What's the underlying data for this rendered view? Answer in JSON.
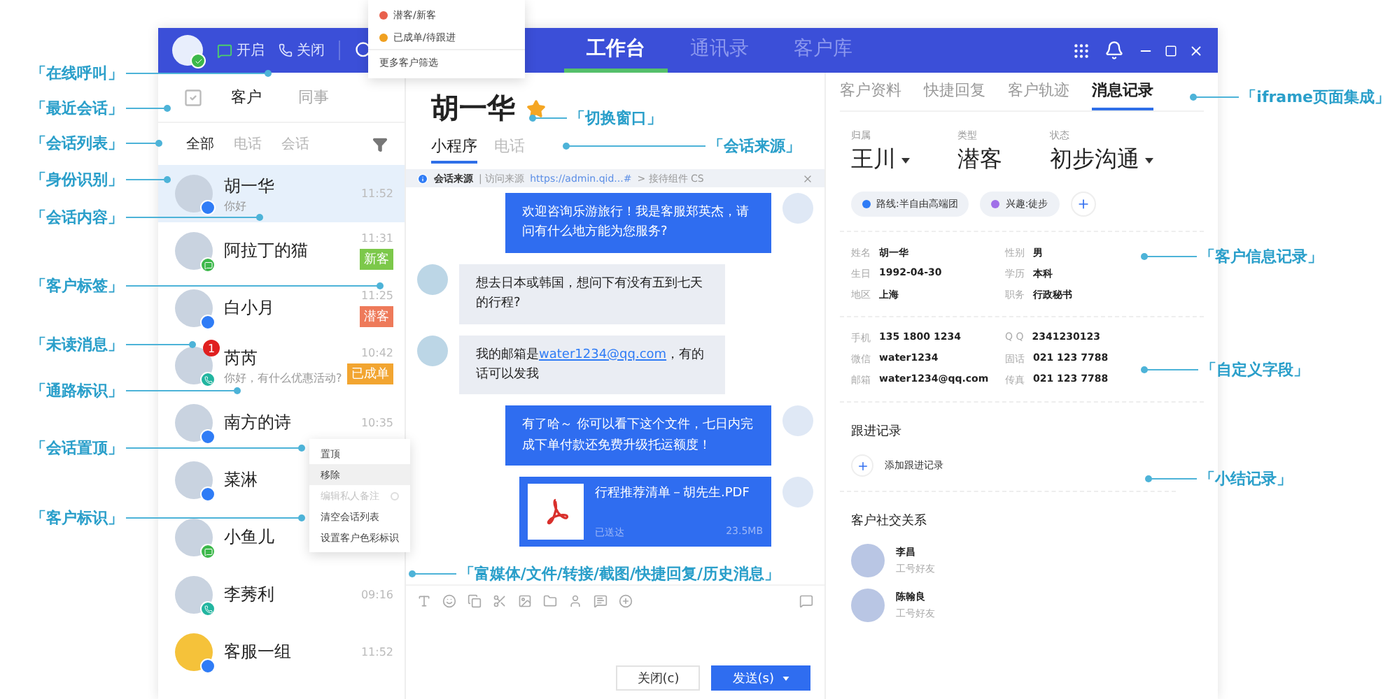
{
  "topbar": {
    "toggles": [
      {
        "label": "开启",
        "kind": "open"
      },
      {
        "label": "关闭",
        "kind": "close"
      }
    ],
    "nav": [
      {
        "label": "工作台",
        "selected": true
      },
      {
        "label": "通讯录",
        "selected": false
      },
      {
        "label": "客户库",
        "selected": false
      }
    ]
  },
  "filter_menu": {
    "items": [
      {
        "label": "潜客/新客",
        "color": "#e8604c"
      },
      {
        "label": "已成单/待跟进",
        "color": "#f0a020"
      }
    ],
    "more": "更多客户筛选"
  },
  "left_panel": {
    "tabs": [
      {
        "label": "客户",
        "selected": true
      },
      {
        "label": "同事",
        "selected": false
      }
    ],
    "filters": [
      {
        "label": "全部",
        "selected": true
      },
      {
        "label": "电话",
        "selected": false
      },
      {
        "label": "会话",
        "selected": false
      }
    ],
    "sessions": [
      {
        "kind": "customer",
        "name": "胡一华",
        "preview": "你好",
        "time": "11:52",
        "selected": true,
        "channel": {
          "kind": "mini"
        }
      },
      {
        "kind": "customer",
        "name": "阿拉丁的猫",
        "time": "11:31",
        "tag": "新客",
        "color": "#7cc84a",
        "selected": false,
        "channel": {
          "kind": "wechat"
        }
      },
      {
        "kind": "customer",
        "name": "白小月",
        "time": "11:25",
        "tag": "潜客",
        "color": "#ee7a5a",
        "selected": false,
        "channel": {
          "kind": "mini"
        }
      },
      {
        "kind": "customer",
        "name": "芮芮",
        "preview": "你好，有什么优惠活动?",
        "time": "10:42",
        "tag": "已成单",
        "color": "#f2a531",
        "unread": "1",
        "selected": false,
        "channel": {
          "kind": "phone"
        }
      },
      {
        "kind": "customer",
        "name": "南方的诗",
        "time": "10:35",
        "selected": false,
        "channel": {
          "kind": "mini"
        }
      },
      {
        "kind": "customer",
        "name": "菜淋",
        "selected": false,
        "channel": {
          "kind": "mini"
        }
      },
      {
        "kind": "customer",
        "name": "小鱼儿",
        "selected": false,
        "channel": {
          "kind": "wechat"
        }
      },
      {
        "kind": "customer",
        "name": "李莠利",
        "time": "09:16",
        "selected": false,
        "channel": {
          "kind": "phone"
        }
      },
      {
        "kind": "group",
        "name": "客服一组",
        "time": "11:52",
        "selected": false,
        "channel": {
          "kind": "mini"
        }
      }
    ],
    "context_menu": [
      {
        "label": "置顶",
        "highlighted": false,
        "disabled": false
      },
      {
        "label": "移除",
        "highlighted": true,
        "disabled": false
      },
      {
        "label": "编辑私人备注",
        "highlighted": false,
        "disabled": true
      },
      {
        "label": "清空会话列表",
        "highlighted": false,
        "disabled": false
      },
      {
        "label": "设置客户色彩标识",
        "highlighted": false,
        "disabled": false
      }
    ]
  },
  "chat": {
    "name": "胡一华",
    "starred": true,
    "tabs": [
      {
        "label": "小程序",
        "selected": true
      },
      {
        "label": "电话",
        "selected": false
      }
    ],
    "source": {
      "title": "会话来源",
      "detail": "| 访问来源",
      "url": "https://admin.qid...#",
      "rest": "> 接待组件 CS"
    },
    "messages": [
      {
        "kind": "text",
        "outgoing": true,
        "text": "欢迎咨询乐游旅行！我是客服郑英杰，请问有什么地方能为您服务?"
      },
      {
        "kind": "text",
        "outgoing": false,
        "text": "想去日本或韩国，想问下有没有五到七天的行程?"
      },
      {
        "kind": "text",
        "outgoing": false,
        "text": "我的邮箱是",
        "link": "water1234@qq.com",
        "text_after": "，有的话可以发我"
      },
      {
        "kind": "text",
        "outgoing": true,
        "text": "有了哈～ 你可以看下这个文件，七日内完成下单付款还免费升级托运额度！"
      },
      {
        "kind": "file",
        "outgoing": true,
        "text": "行程推荐清单－胡先生.PDF",
        "status": "已送达",
        "size": "23.5MB"
      }
    ],
    "buttons": [
      {
        "label": "关闭(c)",
        "kind": "secondary"
      },
      {
        "label": "发送(s)",
        "kind": "primary"
      }
    ]
  },
  "right_panel": {
    "tabs": [
      {
        "label": "客户资料",
        "selected": false
      },
      {
        "label": "快捷回复",
        "selected": false
      },
      {
        "label": "客户轨迹",
        "selected": false
      },
      {
        "label": "消息记录",
        "selected": true
      }
    ],
    "header": [
      {
        "label": "归属",
        "value": "王川",
        "dropdown": true
      },
      {
        "label": "类型",
        "value": "潜客",
        "dropdown": false
      },
      {
        "label": "状态",
        "value": "初步沟通",
        "dropdown": true
      }
    ],
    "tags": [
      {
        "label": "路线:半自由高端团",
        "color": "#2f7cf6"
      },
      {
        "label": "兴趣:徒步",
        "color": "#a070e8"
      }
    ],
    "info": [
      {
        "label": "姓名",
        "value": "胡一华"
      },
      {
        "label": "性别",
        "value": "男"
      },
      {
        "label": "生日",
        "value": "1992-04-30"
      },
      {
        "label": "学历",
        "value": "本科"
      },
      {
        "label": "地区",
        "value": "上海"
      },
      {
        "label": "职务",
        "value": "行政秘书"
      }
    ],
    "custom_fields": [
      {
        "label": "手机",
        "value": "135 1800 1234"
      },
      {
        "label": "Q Q",
        "value": "2341230123"
      },
      {
        "label": "微信",
        "value": "water1234"
      },
      {
        "label": "固话",
        "value": "021 123 7788"
      },
      {
        "label": "邮箱",
        "value": "water1234@qq.com"
      },
      {
        "label": "传真",
        "value": "021 123 7788"
      }
    ],
    "followup": {
      "title": "跟进记录",
      "action": "添加跟进记录"
    },
    "social": {
      "title": "客户社交关系",
      "contacts": [
        {
          "name": "李昌",
          "relation": "工号好友"
        },
        {
          "name": "陈翰良",
          "relation": "工号好友"
        }
      ]
    }
  },
  "callouts": {
    "left": [
      "「在线呼叫」",
      "「最近会话」",
      "「会话列表」",
      "「身份识别」",
      "「会话内容」",
      "「客户标签」",
      "「未读消息」",
      "「通路标识」",
      "「会话置顶」",
      "「客户标识」"
    ],
    "middle": [
      "「切换窗口」",
      "「会话来源」",
      "「富媒体/文件/转接/截图/快捷回复/历史消息」"
    ],
    "right": [
      "「iframe页面集成」",
      "「客户信息记录」",
      "「自定义字段」",
      "「小结记录」"
    ]
  }
}
